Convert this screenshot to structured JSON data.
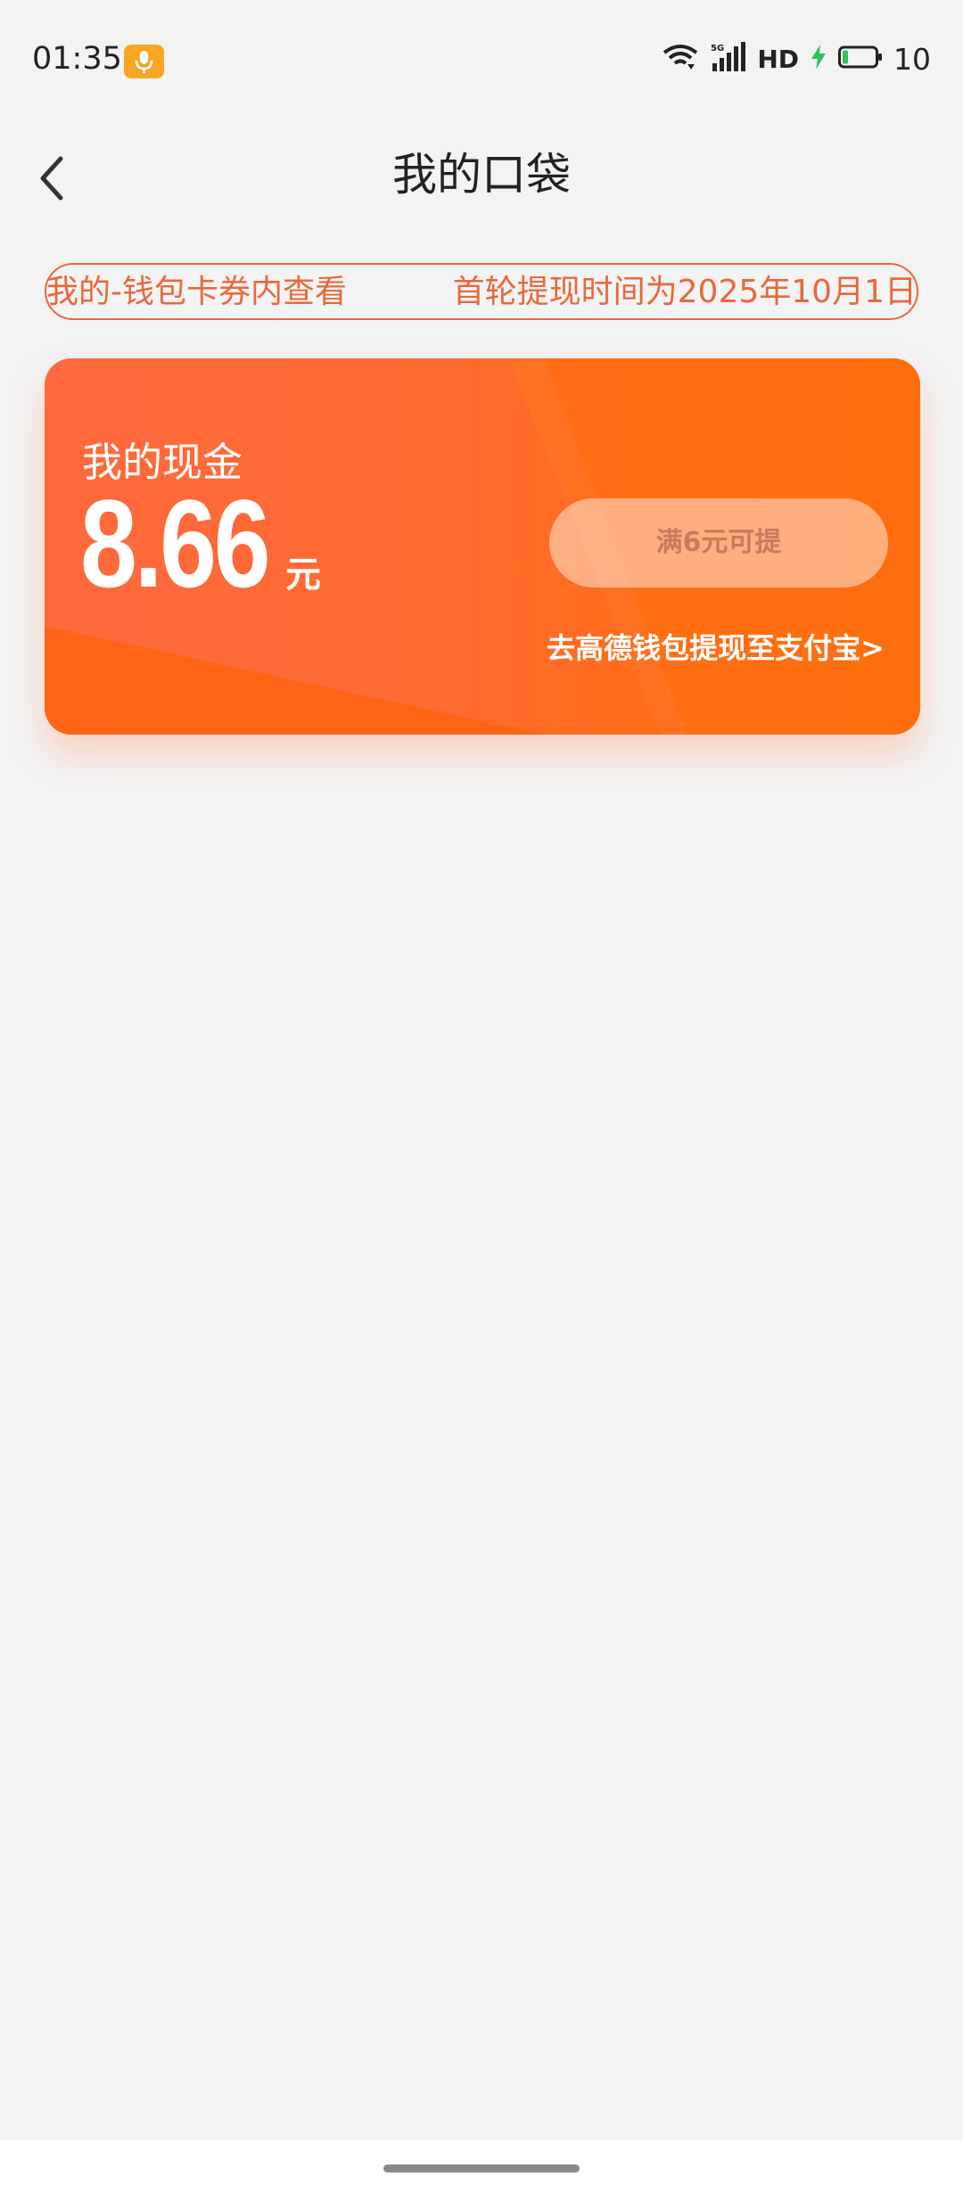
{
  "status_bar": {
    "time": "01:35",
    "network": "5G",
    "hd": "HD",
    "battery": "10",
    "icons": [
      "microphone-icon",
      "wifi-icon",
      "signal-icon",
      "charging-icon",
      "battery-icon"
    ]
  },
  "header": {
    "title": "我的口袋",
    "back_icon": "chevron-left-icon"
  },
  "notice": {
    "left_text": "我的-钱包卡券内查看",
    "right_text": "首轮提现时间为2025年10月1日"
  },
  "cash_card": {
    "label": "我的现金",
    "amount": "8.66",
    "unit": "元",
    "withdraw_button": "满6元可提",
    "alipay_link": "去高德钱包提现至支付宝>"
  },
  "colors": {
    "accent": "#ff6a30",
    "notice": "#e8683a",
    "mic_badge": "#f6a623",
    "charging": "#2fc25b"
  }
}
